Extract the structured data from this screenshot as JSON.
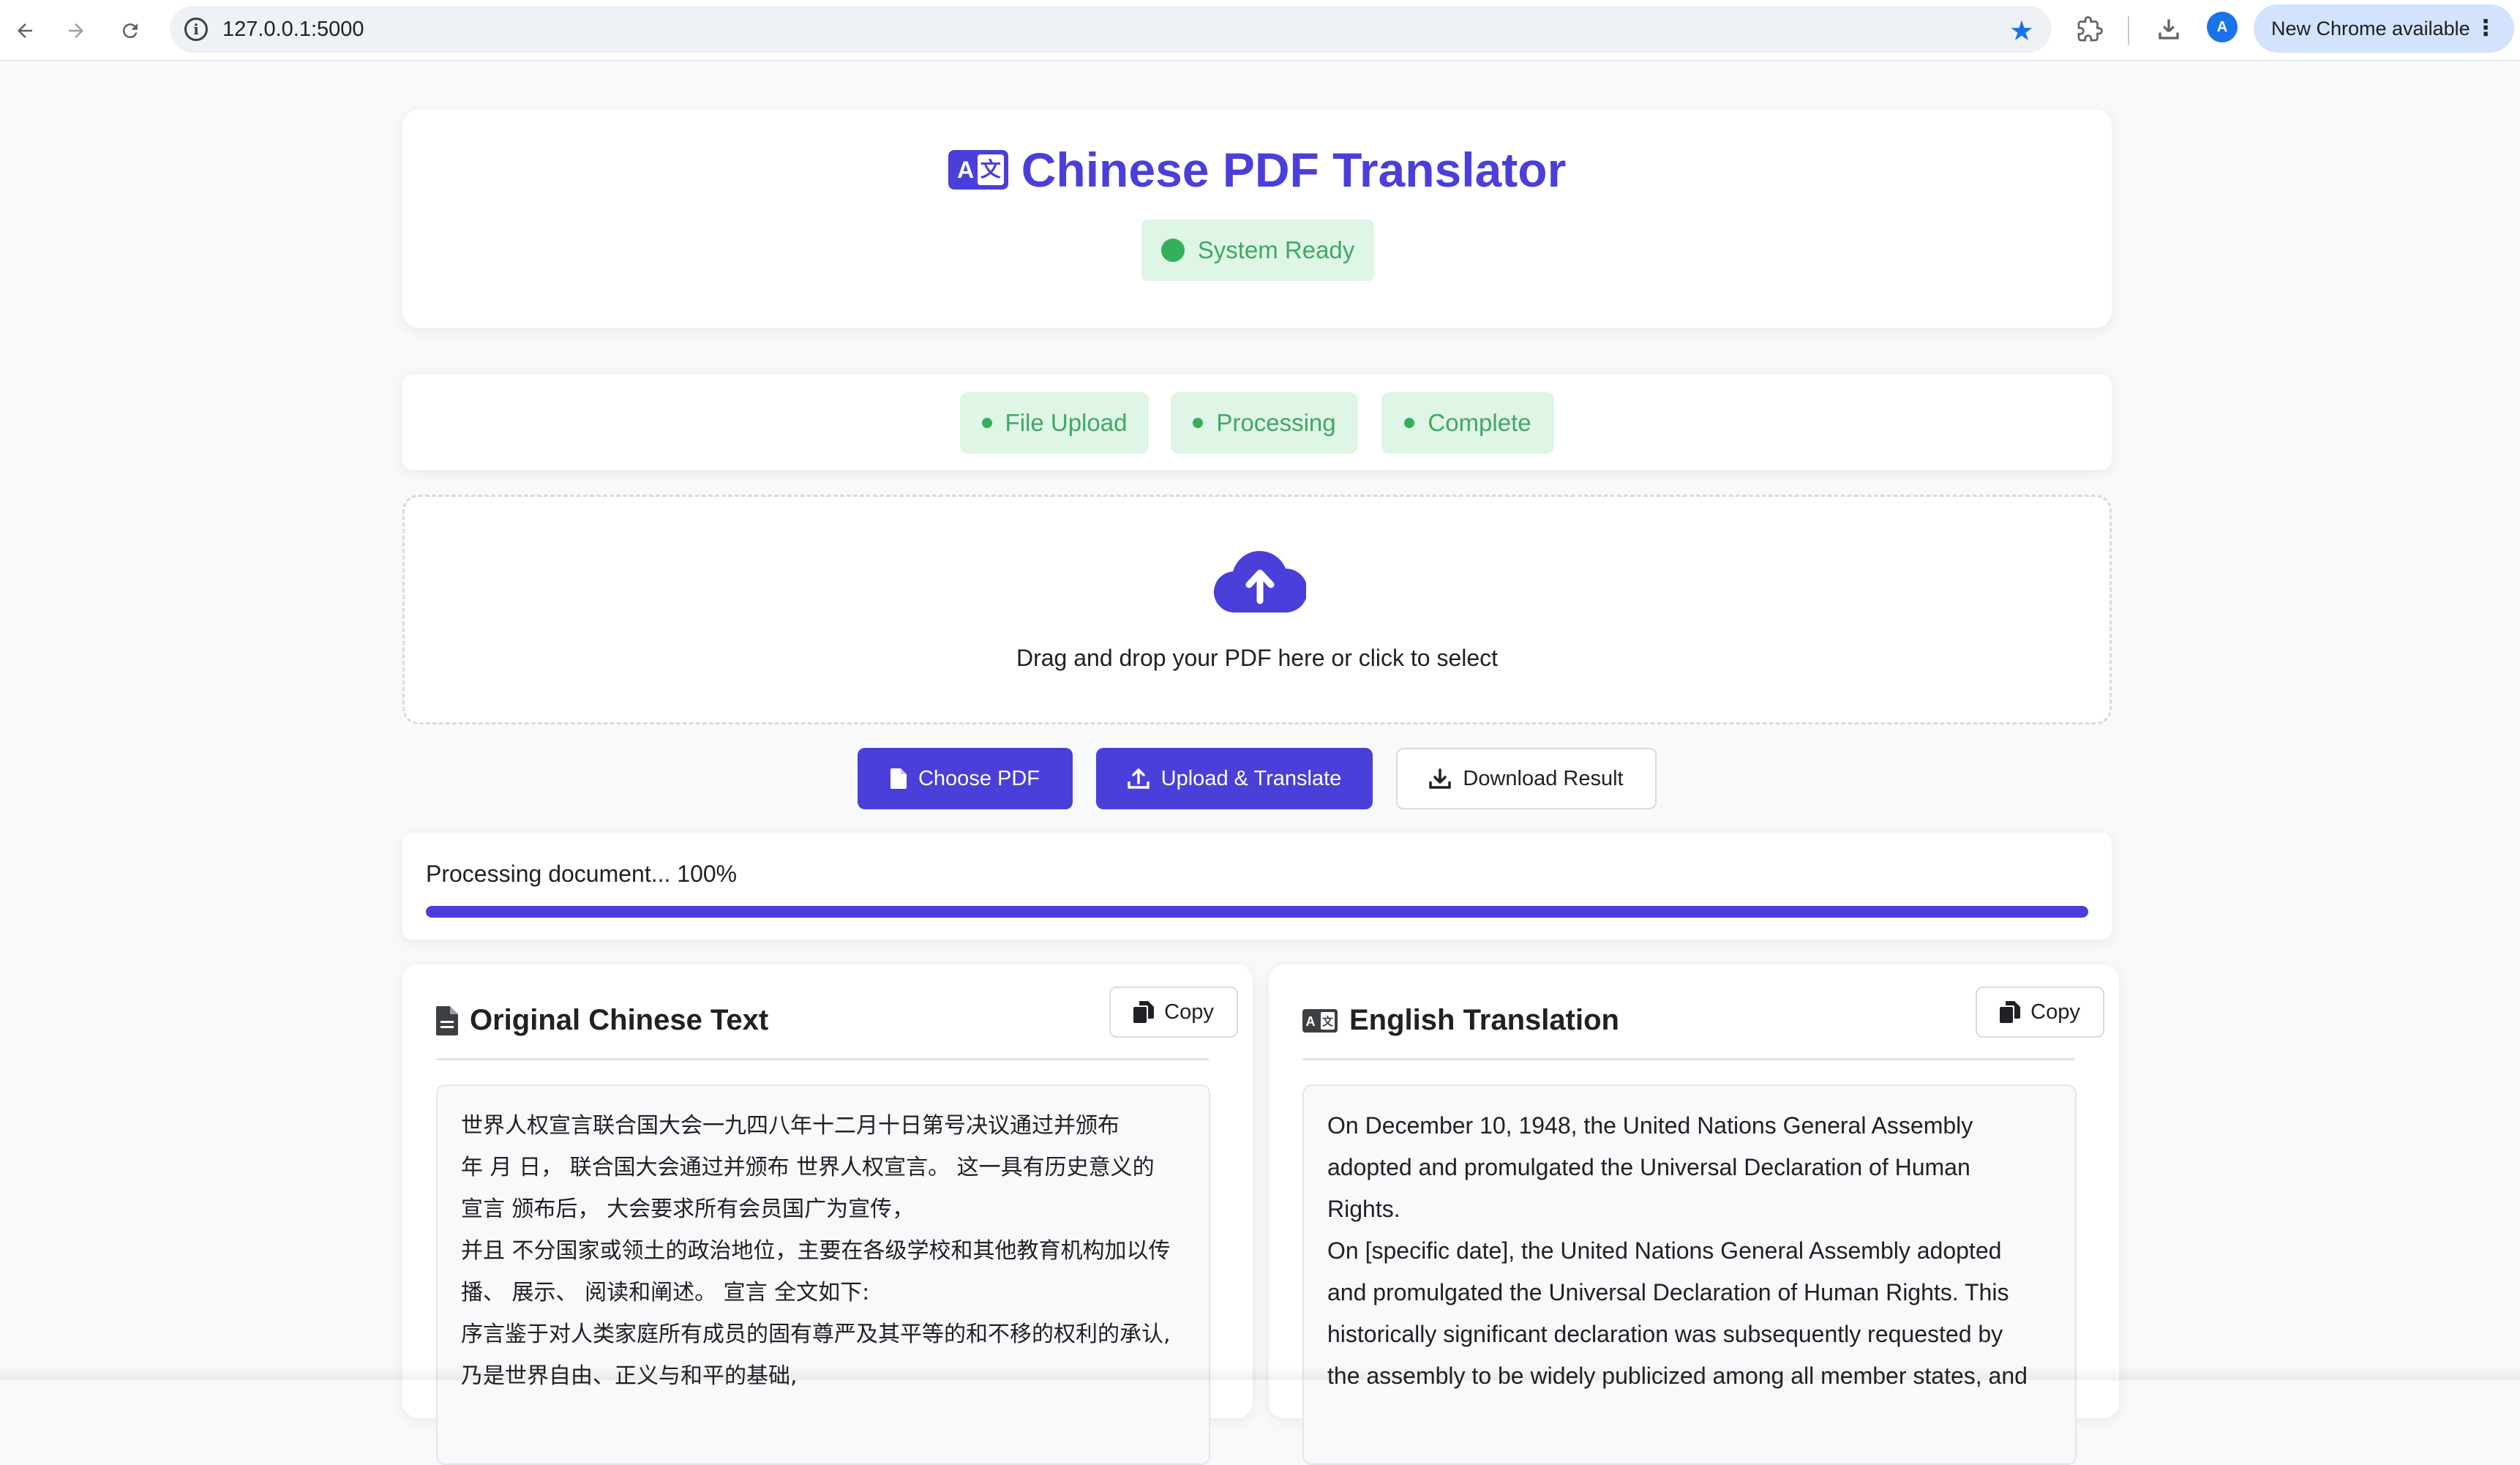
{
  "browser": {
    "url": "127.0.0.1:5000",
    "update_label": "New Chrome available",
    "menu_glyph": "⋮",
    "profile_initial": "A"
  },
  "header": {
    "title": "Chinese PDF Translator",
    "status": "System Ready",
    "icon_left": "A",
    "icon_right": "文"
  },
  "steps": [
    "File Upload",
    "Processing",
    "Complete"
  ],
  "upload": {
    "prompt": "Drag and drop your PDF here or click to select"
  },
  "buttons": {
    "choose": "Choose PDF",
    "upload": "Upload & Translate",
    "download": "Download Result"
  },
  "progress": {
    "label": "Processing document... 100%",
    "value": 1.0
  },
  "panels": {
    "original": {
      "title": "Original Chinese Text",
      "copy": "Copy",
      "lines": [
        "世界人权宣言联合国大会一九四八年十二月十日第号决议通过并颁布",
        " 年 月 日， 联合国大会通过并颁布 世界人权宣言。 这一具有历史意义的",
        "宣言 颁布后， 大会要求所有会员国广为宣传，",
        "并且 不分国家或领土的政治地位，主要在各级学校和其他教育机构加以传",
        "播、 展示、 阅读和阐述。 宣言 全文如下:",
        "序言鉴于对人类家庭所有成员的固有尊严及其平等的和不移的权利的承认,",
        "乃是世界自由、正义与和平的基础,"
      ]
    },
    "translation": {
      "title": "English Translation",
      "copy": "Copy",
      "lines": [
        "On December 10, 1948, the United Nations General Assembly",
        "adopted and promulgated the Universal Declaration of Human",
        "Rights.",
        "On [specific date], the United Nations General Assembly adopted",
        "and promulgated the Universal Declaration of Human Rights. This",
        "historically significant declaration was subsequently requested by",
        "the assembly to be widely publicized among all member states, and"
      ]
    }
  },
  "colors": {
    "accent": "#4a3fd8",
    "success_bg": "#dff5e6",
    "success_text": "#3fa864",
    "success_dot": "#34b05c",
    "chrome_star": "#1a73e8"
  },
  "icons": {
    "back": "arrow-left-icon",
    "forward": "arrow-right-icon",
    "reload": "reload-icon",
    "site_info": "info-icon",
    "bookmark": "star-icon",
    "extensions": "puzzle-icon",
    "downloads": "download-icon",
    "title": "translate-icon",
    "upload": "cloud-upload-icon",
    "document": "document-icon",
    "copy": "copy-icon"
  }
}
